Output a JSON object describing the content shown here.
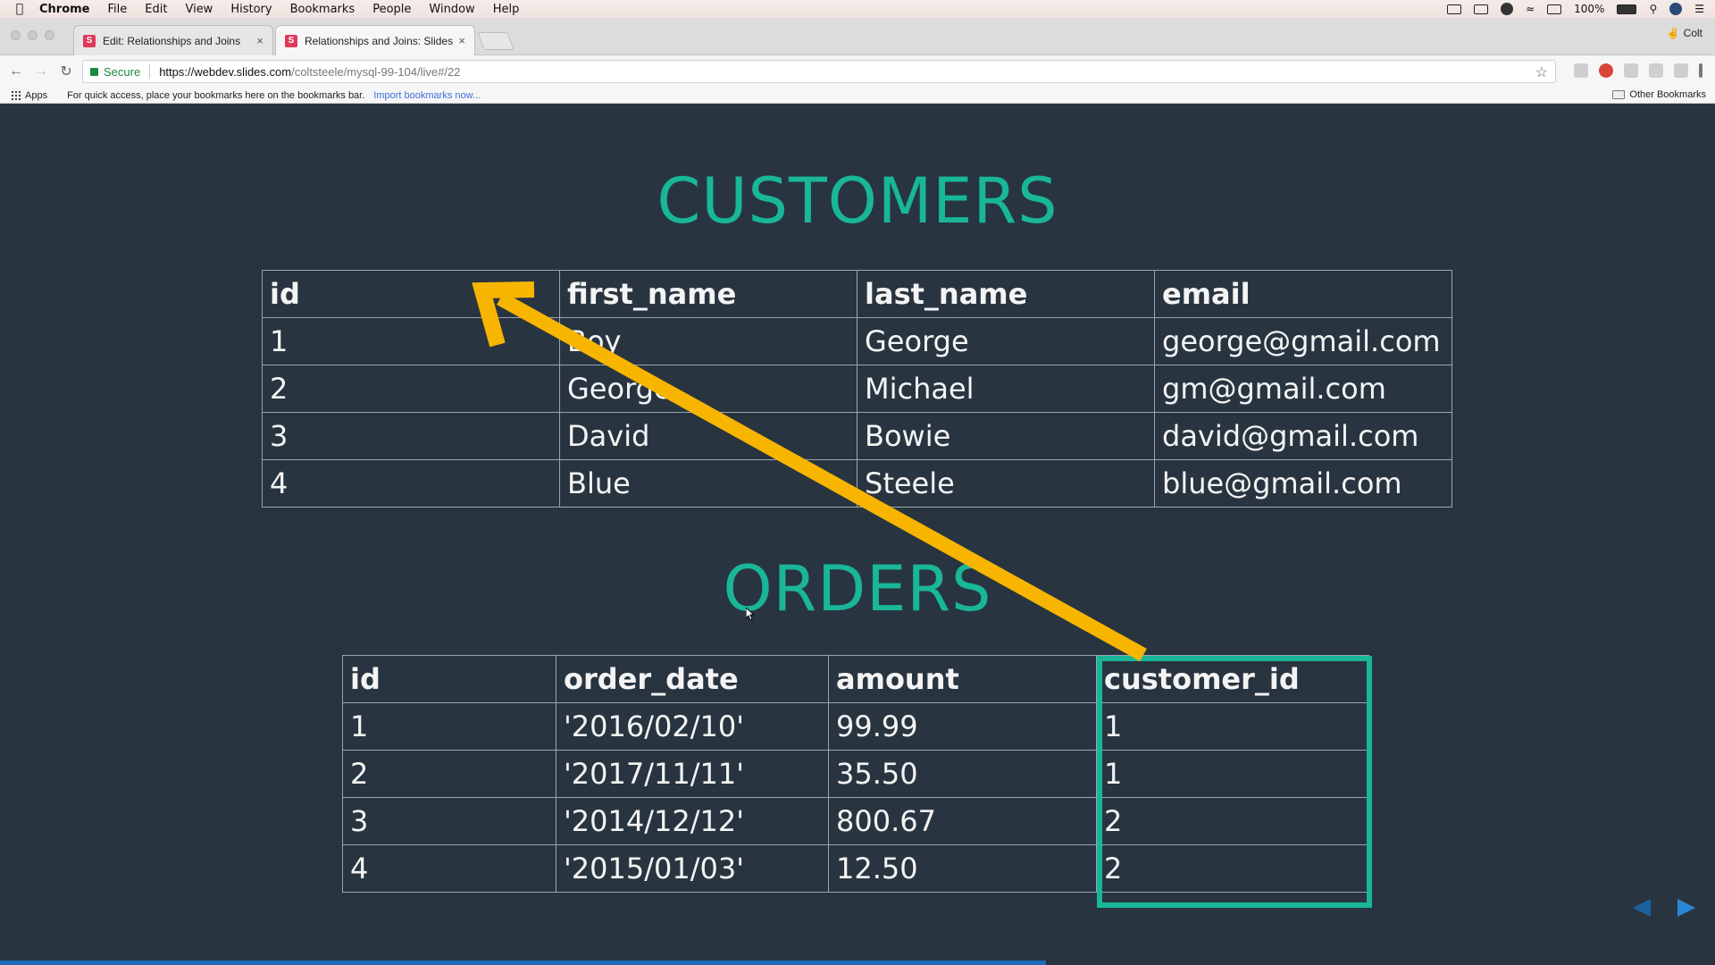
{
  "menubar": {
    "apple": "",
    "items": [
      "Chrome",
      "File",
      "Edit",
      "View",
      "History",
      "Bookmarks",
      "People",
      "Window",
      "Help"
    ],
    "battery": "100%"
  },
  "tabs": [
    {
      "favicon": "S",
      "title": "Edit: Relationships and Joins",
      "close": "×"
    },
    {
      "favicon": "S",
      "title": "Relationships and Joins: Slides",
      "close": "×"
    }
  ],
  "profile": {
    "name": "Colt"
  },
  "toolbar": {
    "secure_label": "Secure",
    "url_host": "https://webdev.slides.com",
    "url_path": "/coltsteele/mysql-99-104/live#/22"
  },
  "bookmarks": {
    "apps_label": "Apps",
    "hint": "For quick access, place your bookmarks here on the bookmarks bar.",
    "import_link": "Import bookmarks now...",
    "other": "Other Bookmarks"
  },
  "slide": {
    "customers_title": "CUSTOMERS",
    "orders_title": "ORDERS",
    "customers": {
      "headers": [
        "id",
        "first_name",
        "last_name",
        "email"
      ],
      "rows": [
        [
          "1",
          "Boy",
          "George",
          "george@gmail.com"
        ],
        [
          "2",
          "George",
          "Michael",
          "gm@gmail.com"
        ],
        [
          "3",
          "David",
          "Bowie",
          "david@gmail.com"
        ],
        [
          "4",
          "Blue",
          "Steele",
          "blue@gmail.com"
        ]
      ]
    },
    "orders": {
      "headers": [
        "id",
        "order_date",
        "amount",
        "customer_id"
      ],
      "rows": [
        [
          "1",
          "'2016/02/10'",
          "99.99",
          "1"
        ],
        [
          "2",
          "'2017/11/11'",
          "35.50",
          "1"
        ],
        [
          "3",
          "'2014/12/12'",
          "800.67",
          "2"
        ],
        [
          "4",
          "'2015/01/03'",
          "12.50",
          "2"
        ]
      ]
    },
    "colors": {
      "accent": "#19b698",
      "arrow": "#f7b500",
      "background": "#283540"
    },
    "progress_fraction": 0.61
  }
}
